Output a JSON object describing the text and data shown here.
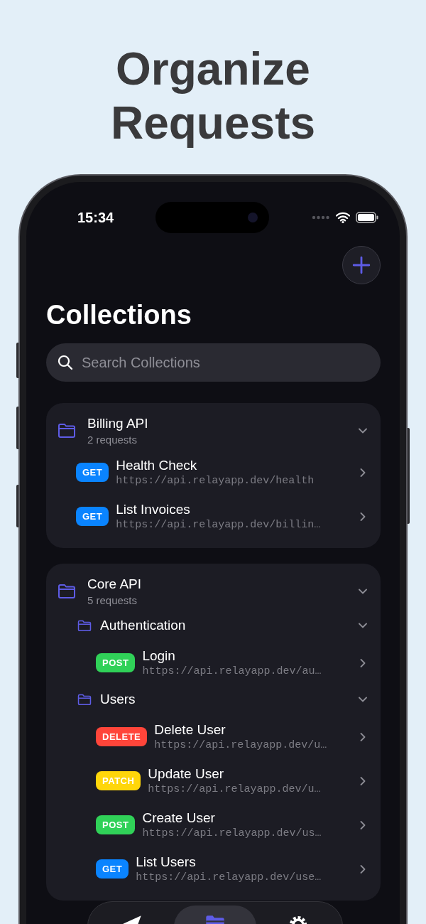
{
  "headline": "Organize Requests",
  "status_bar": {
    "time": "15:34"
  },
  "title": "Collections",
  "search": {
    "placeholder": "Search Collections"
  },
  "collections": [
    {
      "name": "Billing API",
      "count": "2 requests",
      "expanded": true,
      "children": [
        {
          "kind": "request",
          "method": "GET",
          "color": "#0a84ff",
          "name": "Health Check",
          "url": "https://api.relayapp.dev/health"
        },
        {
          "kind": "request",
          "method": "GET",
          "color": "#0a84ff",
          "name": "List Invoices",
          "url": "https://api.relayapp.dev/billin…"
        }
      ]
    },
    {
      "name": "Core API",
      "count": "5 requests",
      "expanded": true,
      "children": [
        {
          "kind": "folder",
          "name": "Authentication",
          "expanded": true,
          "children": [
            {
              "kind": "request",
              "method": "POST",
              "color": "#30d158",
              "name": "Login",
              "url": "https://api.relayapp.dev/au…"
            }
          ]
        },
        {
          "kind": "folder",
          "name": "Users",
          "expanded": true,
          "children": [
            {
              "kind": "request",
              "method": "DELETE",
              "color": "#ff453a",
              "name": "Delete User",
              "url": "https://api.relayapp.dev/u…"
            },
            {
              "kind": "request",
              "method": "PATCH",
              "color": "#ffd60a",
              "name": "Update User",
              "url": "https://api.relayapp.dev/u…"
            },
            {
              "kind": "request",
              "method": "POST",
              "color": "#30d158",
              "name": "Create User",
              "url": "https://api.relayapp.dev/us…"
            },
            {
              "kind": "request",
              "method": "GET",
              "color": "#0a84ff",
              "name": "List Users",
              "url": "https://api.relayapp.dev/use…"
            }
          ]
        }
      ]
    }
  ],
  "tabs": [
    {
      "selected": false
    },
    {
      "selected": true
    },
    {
      "selected": false
    }
  ]
}
